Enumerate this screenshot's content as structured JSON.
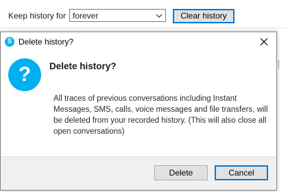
{
  "background_settings": {
    "label": "Keep history for",
    "select_value": "forever",
    "clear_button": "Clear history"
  },
  "dialog": {
    "title": "Delete history?",
    "app_icon": "skype-logo-icon",
    "close_icon": "close-icon",
    "question_icon": "question-mark-icon",
    "heading": "Delete history?",
    "message": "All traces of previous conversations including Instant Messages, SMS, calls, voice messages and file transfers, will be deleted from your recorded history. (This will also close all open conversations)",
    "buttons": {
      "delete": "Delete",
      "cancel": "Cancel"
    }
  },
  "colors": {
    "accent": "#00aff0",
    "focus_border": "#0078d7",
    "footer_bg": "#f0f0f0"
  }
}
